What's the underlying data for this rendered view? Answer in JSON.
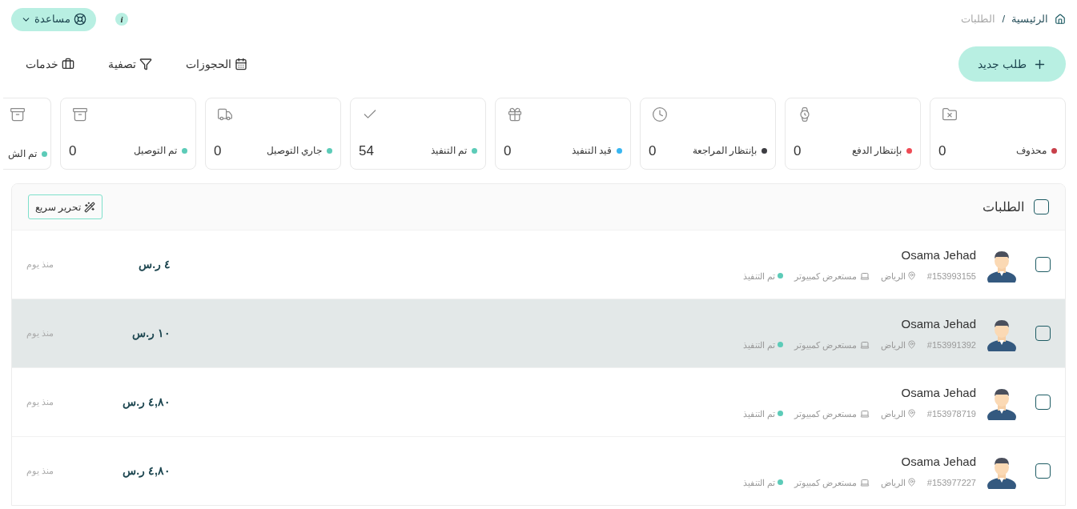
{
  "breadcrumb": [
    {
      "label": "الرئيسية",
      "selected": false
    },
    {
      "label": "/",
      "selected": false
    },
    {
      "label": "الطلبات",
      "selected": true
    }
  ],
  "help_button": {
    "label": "مساعدة"
  },
  "info_badge": {
    "label": "i"
  },
  "new_order_button": {
    "label": "طلب جديد"
  },
  "toolbar": [
    {
      "label": "الحجوزات"
    },
    {
      "label": "تصفية"
    },
    {
      "label": "خدمات"
    }
  ],
  "status_cards": [
    {
      "label": "محذوف",
      "count": "0",
      "color": "#c8404a"
    },
    {
      "label": "بإنتظار الدفع",
      "count": "0",
      "color": "#ef4b55"
    },
    {
      "label": "بإنتظار المراجعة",
      "count": "0",
      "color": "#3d3d42"
    },
    {
      "label": "قيد التنفيذ",
      "count": "0",
      "color": "#38b6f1"
    },
    {
      "label": "تم التنفيذ",
      "count": "54",
      "color": "#5ccbb8"
    },
    {
      "label": "جاري التوصيل",
      "count": "0",
      "color": "#5ccbb8"
    },
    {
      "label": "تم التوصيل",
      "count": "0",
      "color": "#5ccbb8"
    },
    {
      "label": "تم الش",
      "color": "#5ccbb8"
    }
  ],
  "orders_header": {
    "title": "الطلبات",
    "checked": false,
    "quick_edit": "تحرير سريع"
  },
  "orders": [
    {
      "name": "Osama Jehad",
      "number": "#153993155",
      "city": "الرياض",
      "source": "مستعرض كمبيوتر",
      "status": "تم التنفيذ",
      "color": "#5ccbb8",
      "amount": "٤ ر.س",
      "time": "منذ يوم",
      "checked": false,
      "selected": false
    },
    {
      "name": "Osama Jehad",
      "number": "#153991392",
      "city": "الرياض",
      "source": "مستعرض كمبيوتر",
      "status": "تم التنفيذ",
      "color": "#5ccbb8",
      "amount": "١٠ ر.س",
      "time": "منذ يوم",
      "checked": false,
      "selected": true
    },
    {
      "name": "Osama Jehad",
      "number": "#153978719",
      "city": "الرياض",
      "source": "مستعرض كمبيوتر",
      "status": "تم التنفيذ",
      "color": "#5ccbb8",
      "amount": "٤,٨٠ ر.س",
      "time": "منذ يوم",
      "checked": false,
      "selected": false
    },
    {
      "name": "Osama Jehad",
      "number": "#153977227",
      "city": "الرياض",
      "source": "مستعرض كمبيوتر",
      "status": "تم التنفيذ",
      "color": "#5ccbb8",
      "amount": "٤,٨٠ ر.س",
      "time": "منذ يوم",
      "checked": false,
      "selected": false
    }
  ]
}
